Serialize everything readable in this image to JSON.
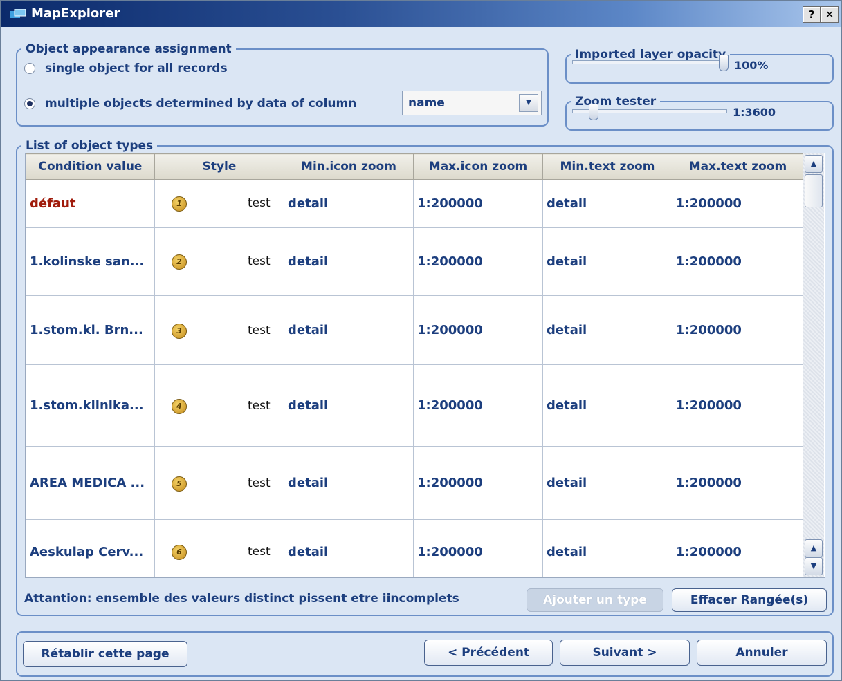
{
  "window": {
    "title": "MapExplorer",
    "help_label": "?",
    "close_label": "✕"
  },
  "appearance": {
    "legend": "Object appearance assignment",
    "option_single": "single object for all records",
    "option_multiple": "multiple objects determined by data of column",
    "selected_option": "multiple",
    "column_value": "name"
  },
  "opacity": {
    "legend": "Imported layer opacity",
    "value_text": "100%",
    "level": 1.0
  },
  "zoom": {
    "legend": "Zoom tester",
    "value_text": "1:3600",
    "level": 0.0
  },
  "list": {
    "legend": "List of object types",
    "columns": [
      "Condition value",
      "Style",
      "Min.icon zoom",
      "Max.icon zoom",
      "Min.text zoom",
      "Max.text zoom"
    ],
    "rows": [
      {
        "condition": "défaut",
        "badge": "1",
        "style": "test",
        "min_icon": "detail",
        "max_icon": "1:200000",
        "min_text": "detail",
        "max_text": "1:200000"
      },
      {
        "condition": "1.kolinske san...",
        "badge": "2",
        "style": "test",
        "min_icon": "detail",
        "max_icon": "1:200000",
        "min_text": "detail",
        "max_text": "1:200000"
      },
      {
        "condition": "1.stom.kl. Brn...",
        "badge": "3",
        "style": "test",
        "min_icon": "detail",
        "max_icon": "1:200000",
        "min_text": "detail",
        "max_text": "1:200000"
      },
      {
        "condition": "1.stom.klinika...",
        "badge": "4",
        "style": "test",
        "min_icon": "detail",
        "max_icon": "1:200000",
        "min_text": "detail",
        "max_text": "1:200000"
      },
      {
        "condition": "AREA MEDICA ...",
        "badge": "5",
        "style": "test",
        "min_icon": "detail",
        "max_icon": "1:200000",
        "min_text": "detail",
        "max_text": "1:200000"
      },
      {
        "condition": "Aeskulap Cerv...",
        "badge": "6",
        "style": "test",
        "min_icon": "detail",
        "max_icon": "1:200000",
        "min_text": "detail",
        "max_text": "1:200000"
      }
    ]
  },
  "warning": "Attantion: ensemble des valeurs distinct pissent etre iincomplets",
  "buttons": {
    "add_type": "Ajouter un type",
    "delete_rows": "Effacer Rangée(s)",
    "reset": "Rétablir cette page",
    "previous_prefix": "< ",
    "previous_accel": "P",
    "previous_rest": "récédent",
    "next_accel": "S",
    "next_rest": "uivant >",
    "cancel_accel": "A",
    "cancel_rest": "nnuler"
  },
  "colors": {
    "title_gradient_start": "#0b2a6b",
    "accent": "#1c3e7e",
    "default_row_text": "#a01c0c"
  }
}
